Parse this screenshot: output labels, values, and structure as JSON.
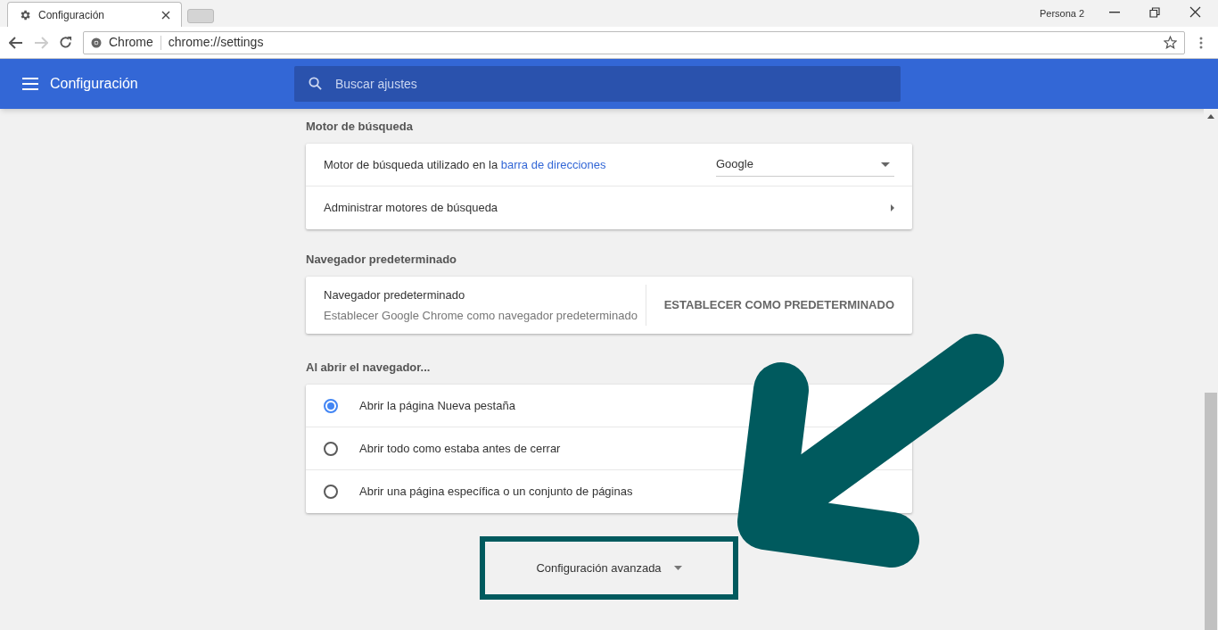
{
  "browser": {
    "tab": {
      "title": "Configuración"
    },
    "profile": "Persona 2",
    "omnibox": {
      "site": "Chrome",
      "url": "chrome://settings"
    }
  },
  "header": {
    "title": "Configuración",
    "search": {
      "placeholder": "Buscar ajustes"
    }
  },
  "sections": [
    {
      "kind": "search",
      "title": "Motor de búsqueda",
      "engine_row": {
        "text": "Motor de búsqueda utilizado en la",
        "link": "barra de direcciones",
        "value": "Google"
      },
      "manage_row": {
        "text": "Administrar motores de búsqueda"
      }
    },
    {
      "kind": "default",
      "title": "Navegador predeterminado",
      "row": {
        "title": "Navegador predeterminado",
        "subtitle": "Establecer Google Chrome como navegador predeterminado",
        "button": "ESTABLECER COMO PREDETERMINADO"
      }
    },
    {
      "kind": "startup",
      "title": "Al abrir el navegador...",
      "options": [
        {
          "label": "Abrir la página Nueva pestaña",
          "selected": true
        },
        {
          "label": "Abrir todo como estaba antes de cerrar",
          "selected": false
        },
        {
          "label": "Abrir una página específica o un conjunto de páginas",
          "selected": false
        }
      ]
    }
  ],
  "advanced": {
    "label": "Configuración avanzada"
  }
}
